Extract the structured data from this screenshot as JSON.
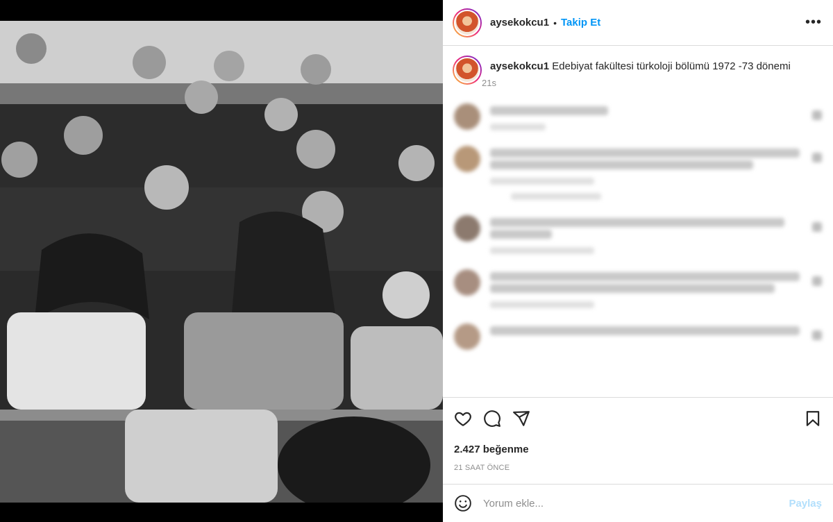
{
  "post": {
    "username": "aysekokcu1",
    "follow_label": "Takip Et",
    "caption_text": "Edebiyat fakültesi türkoloji bölümü 1972 -73 dönemi",
    "caption_time": "21s",
    "likes": "2.427 beğenme",
    "time_ago": "21 SAAT ÖNCE"
  },
  "comment_box": {
    "placeholder": "Yorum ekle...",
    "share_label": "Paylaş"
  },
  "colors": {
    "accent": "#0095f6",
    "share_disabled": "#b2dffc",
    "border": "#dbdbdb"
  },
  "icons": [
    "more-icon",
    "heart-icon",
    "comment-icon",
    "share-icon",
    "bookmark-icon",
    "emoji-icon"
  ]
}
